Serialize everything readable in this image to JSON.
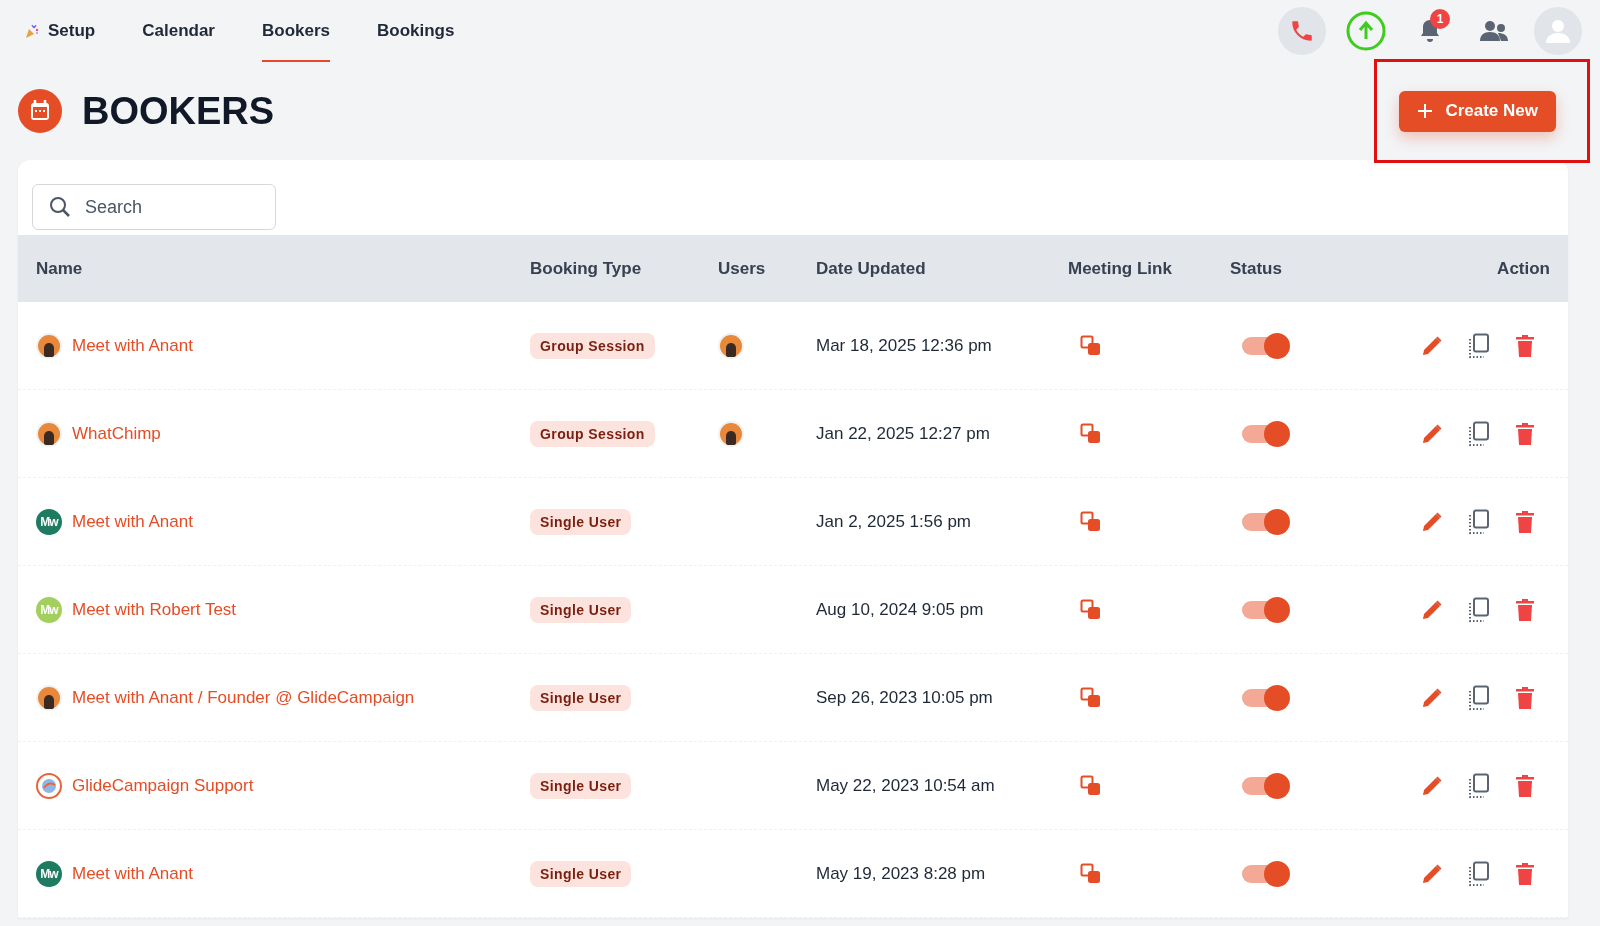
{
  "nav": {
    "tabs": [
      {
        "label": "Setup",
        "selected": false
      },
      {
        "label": "Calendar",
        "selected": false
      },
      {
        "label": "Bookers",
        "selected": true
      },
      {
        "label": "Bookings",
        "selected": false
      }
    ],
    "notification_count": "1"
  },
  "page": {
    "title": "BOOKERS",
    "create_button": "Create New"
  },
  "search": {
    "placeholder": "Search"
  },
  "table": {
    "columns": [
      "Name",
      "Booking Type",
      "Users",
      "Date Updated",
      "Meeting Link",
      "Status",
      "Action"
    ],
    "rows": [
      {
        "avatar": {
          "kind": "photo"
        },
        "name": "Meet with Anant",
        "type": "Group Session",
        "users": [
          {
            "kind": "photo"
          }
        ],
        "date": "Mar 18, 2025 12:36 pm",
        "status_on": true
      },
      {
        "avatar": {
          "kind": "photo"
        },
        "name": "WhatChimp",
        "type": "Group Session",
        "users": [
          {
            "kind": "photo"
          }
        ],
        "date": "Jan 22, 2025 12:27 pm",
        "status_on": true
      },
      {
        "avatar": {
          "kind": "initials",
          "text": "Mw",
          "color": "#1e7b62"
        },
        "name": "Meet with Anant",
        "type": "Single User",
        "date": "Jan 2, 2025 1:56 pm",
        "status_on": true
      },
      {
        "avatar": {
          "kind": "initials",
          "text": "Mw",
          "color": "#a3cf5e"
        },
        "name": "Meet with Robert Test",
        "type": "Single User",
        "date": "Aug 10, 2024 9:05 pm",
        "status_on": true
      },
      {
        "avatar": {
          "kind": "photo"
        },
        "name": "Meet with Anant / Founder @ GlideCampaign",
        "type": "Single User",
        "date": "Sep 26, 2023 10:05 pm",
        "status_on": true
      },
      {
        "avatar": {
          "kind": "logo"
        },
        "name": "GlideCampaign Support",
        "type": "Single User",
        "date": "May 22, 2023 10:54 am",
        "status_on": true
      },
      {
        "avatar": {
          "kind": "initials",
          "text": "Mw",
          "color": "#1e7b62"
        },
        "name": "Meet with Anant",
        "type": "Single User",
        "date": "May 19, 2023 8:28 pm",
        "status_on": true
      }
    ]
  }
}
